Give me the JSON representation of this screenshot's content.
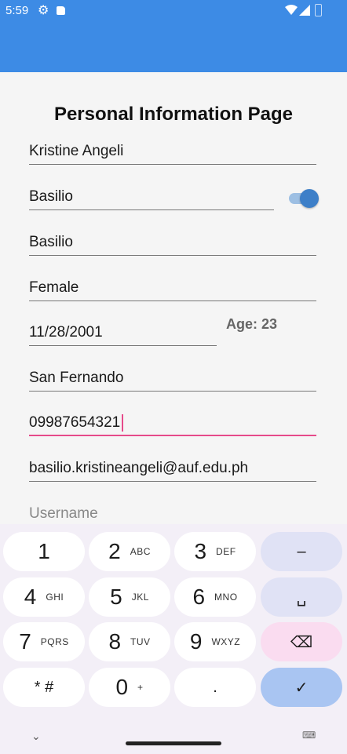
{
  "status_bar": {
    "time": "5:59",
    "icons": [
      "gear-icon",
      "sd-card-icon",
      "wifi-icon",
      "signal-icon",
      "battery-icon"
    ]
  },
  "page": {
    "title": "Personal Information Page",
    "fields": {
      "first_name": "Kristine Angeli",
      "middle_name": "Basilio",
      "last_name": "Basilio",
      "gender": "Female",
      "birthdate": "11/28/2001",
      "city": "San Fernando",
      "phone": "09987654321",
      "email": "basilio.kristineangeli@auf.edu.ph",
      "username_placeholder": "Username"
    },
    "age_label": "Age: 23",
    "toggle_on": true
  },
  "keyboard": {
    "rows": [
      [
        {
          "main": "1",
          "sub": ""
        },
        {
          "main": "2",
          "sub": "ABC"
        },
        {
          "main": "3",
          "sub": "DEF"
        },
        {
          "main": "–",
          "sub": "",
          "type": "fn"
        }
      ],
      [
        {
          "main": "4",
          "sub": "GHI"
        },
        {
          "main": "5",
          "sub": "JKL"
        },
        {
          "main": "6",
          "sub": "MNO"
        },
        {
          "main": "␣",
          "sub": "",
          "type": "fn"
        }
      ],
      [
        {
          "main": "7",
          "sub": "PQRS"
        },
        {
          "main": "8",
          "sub": "TUV"
        },
        {
          "main": "9",
          "sub": "WXYZ"
        },
        {
          "main": "⌫",
          "sub": "",
          "type": "del"
        }
      ],
      [
        {
          "main": "* #",
          "sub": ""
        },
        {
          "main": "0",
          "sub": "+"
        },
        {
          "main": ".",
          "sub": ""
        },
        {
          "main": "✓",
          "sub": "",
          "type": "done"
        }
      ]
    ],
    "hide_label": "⌄",
    "switch_label": "⌨"
  },
  "colors": {
    "primary": "#3d8be5",
    "accent": "#e64a8a",
    "background": "#f5f5f5"
  }
}
